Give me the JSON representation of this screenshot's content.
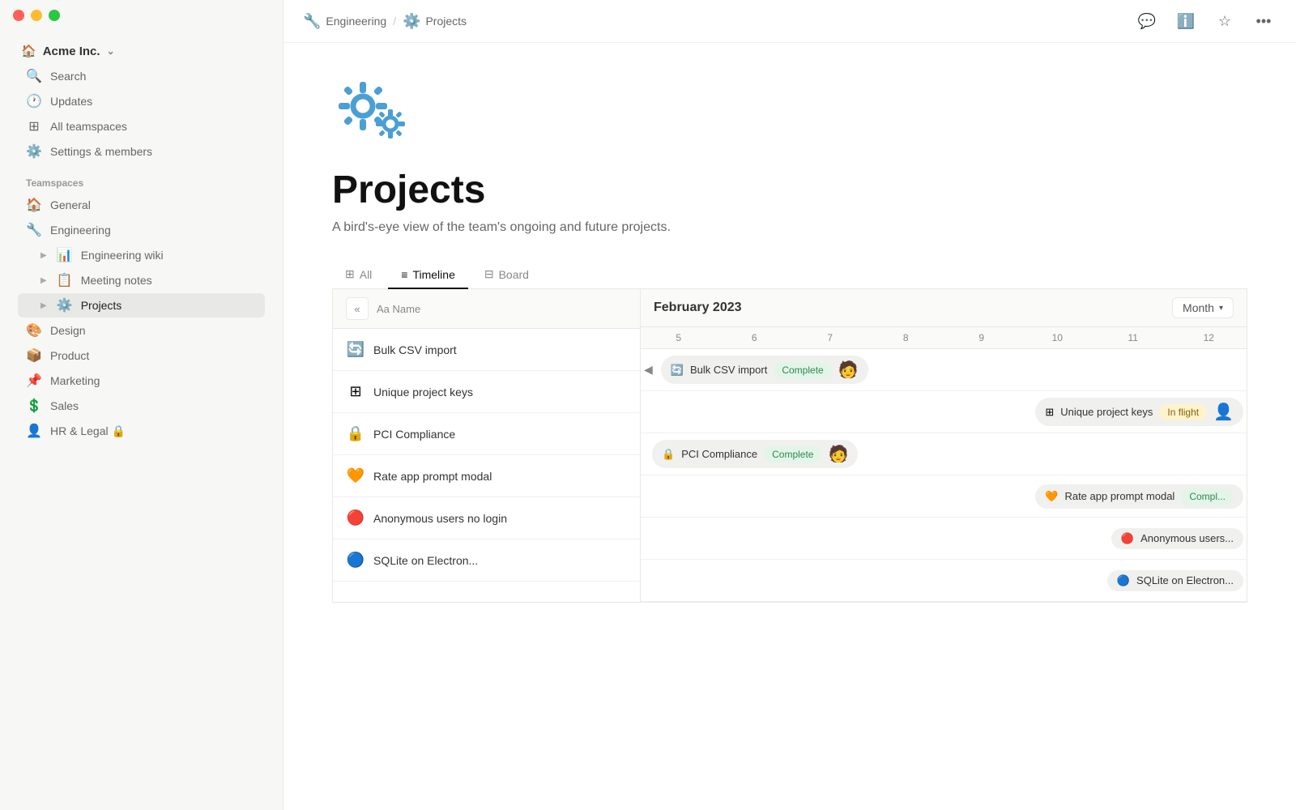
{
  "window": {
    "controls": [
      "close",
      "minimize",
      "maximize"
    ]
  },
  "breadcrumb": {
    "items": [
      {
        "icon": "🔧",
        "label": "Engineering"
      },
      {
        "icon": "⚙️",
        "label": "Projects"
      }
    ],
    "separator": "/"
  },
  "header_actions": [
    {
      "name": "comment-icon",
      "symbol": "💬"
    },
    {
      "name": "info-icon",
      "symbol": "ℹ️"
    },
    {
      "name": "star-icon",
      "symbol": "☆"
    },
    {
      "name": "more-icon",
      "symbol": "•••"
    }
  ],
  "sidebar": {
    "workspace": {
      "name": "Acme Inc.",
      "icon": "🏠"
    },
    "nav_items": [
      {
        "id": "search",
        "icon": "🔍",
        "label": "Search"
      },
      {
        "id": "updates",
        "icon": "🕐",
        "label": "Updates"
      },
      {
        "id": "all-teamspaces",
        "icon": "▦",
        "label": "All teamspaces"
      },
      {
        "id": "settings",
        "icon": "⚙️",
        "label": "Settings & members"
      }
    ],
    "section_label": "Teamspaces",
    "teamspace_items": [
      {
        "id": "general",
        "icon": "🏠",
        "label": "General",
        "expandable": false
      },
      {
        "id": "engineering",
        "icon": "🔧",
        "label": "Engineering",
        "expandable": false
      },
      {
        "id": "engineering-wiki",
        "icon": "📊",
        "label": "Engineering wiki",
        "expandable": true,
        "indent": true
      },
      {
        "id": "meeting-notes",
        "icon": "📋",
        "label": "Meeting notes",
        "expandable": true,
        "indent": true
      },
      {
        "id": "projects",
        "icon": "⚙️",
        "label": "Projects",
        "expandable": true,
        "indent": true,
        "active": true
      },
      {
        "id": "design",
        "icon": "🎨",
        "label": "Design",
        "expandable": false
      },
      {
        "id": "product",
        "icon": "📦",
        "label": "Product",
        "expandable": false
      },
      {
        "id": "marketing",
        "icon": "📌",
        "label": "Marketing",
        "expandable": false
      },
      {
        "id": "sales",
        "icon": "💲",
        "label": "Sales",
        "expandable": false
      },
      {
        "id": "hr-legal",
        "icon": "👤",
        "label": "HR & Legal 🔒",
        "expandable": false
      }
    ]
  },
  "page": {
    "emoji": "⚙️",
    "title": "Projects",
    "description": "A bird's-eye view of the team's ongoing and future projects."
  },
  "tabs": [
    {
      "id": "all",
      "icon": "▦",
      "label": "All"
    },
    {
      "id": "timeline",
      "icon": "≡",
      "label": "Timeline",
      "active": true
    },
    {
      "id": "board",
      "icon": "▦",
      "label": "Board"
    }
  ],
  "timeline": {
    "collapse_btn": "«",
    "name_col": "Name",
    "month_display": "February 2023",
    "month_selector": "Month",
    "dates": [
      "5",
      "6",
      "7",
      "8",
      "9",
      "10",
      "11",
      "12"
    ],
    "projects": [
      {
        "id": "bulk-csv",
        "icon": "🔄",
        "label": "Bulk CSV import",
        "bar_icon": "🔄",
        "bar_label": "Bulk CSV import",
        "badge": "Complete",
        "badge_type": "complete",
        "has_avatar": true,
        "has_back": true
      },
      {
        "id": "unique-keys",
        "icon": "▦",
        "label": "Unique project keys",
        "bar_icon": "▦",
        "bar_label": "Unique project keys",
        "badge": "In flight",
        "badge_type": "inflight",
        "has_avatar": true
      },
      {
        "id": "pci",
        "icon": "🔒",
        "label": "PCI Compliance",
        "bar_icon": "🔒",
        "bar_label": "PCI Compliance",
        "badge": "Complete",
        "badge_type": "complete",
        "has_avatar": true
      },
      {
        "id": "rate-app",
        "icon": "🧡",
        "label": "Rate app prompt modal",
        "bar_icon": "🧡",
        "bar_label": "Rate app prompt modal",
        "badge": "Compl...",
        "badge_type": "complete",
        "has_avatar": false
      },
      {
        "id": "anon-users",
        "icon": "🔴",
        "label": "Anonymous users no login",
        "bar_icon": "🔴",
        "bar_label": "Anonymous users...",
        "badge": "",
        "badge_type": "",
        "has_avatar": false
      },
      {
        "id": "sqlite",
        "icon": "🔵",
        "label": "SQLite on Electron...",
        "bar_icon": "🔵",
        "bar_label": "SQLite on Electron...",
        "badge": "",
        "badge_type": "",
        "has_avatar": false
      }
    ]
  }
}
